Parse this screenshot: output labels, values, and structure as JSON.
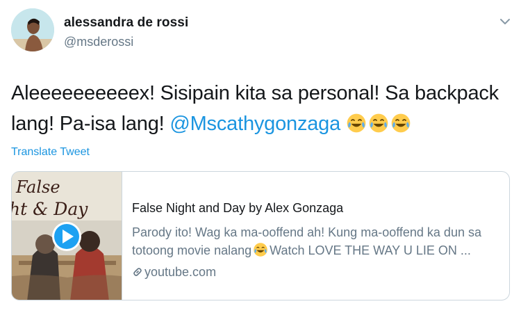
{
  "author": {
    "display_name": "alessandra de rossi",
    "handle": "@msderossi"
  },
  "tweet": {
    "text_main": "Aleeeeeeeeeex! Sisipain kita sa personal! Sa backpack lang! Pa-isa lang!",
    "mention": "@Mscathygonzaga",
    "emoji_name": "face-with-tears-of-joy",
    "emoji_count": 3
  },
  "translate_label": "Translate Tweet",
  "card": {
    "thumbnail_text_line1": "False",
    "thumbnail_text_line2": "ht & Day",
    "title": "False Night and Day by Alex Gonzaga",
    "description_part1": "Parody ito! Wag ka ma-ooffend ah! Kung ma-ooffend ka dun sa totoong movie nalang",
    "description_part2": "Watch LOVE THE WAY U LIE ON ...",
    "domain": "youtube.com",
    "play_icon": "play-icon",
    "link_icon": "link-icon"
  },
  "icons": {
    "caret": "chevron-down-icon"
  },
  "colors": {
    "link_blue": "#1b95e0",
    "secondary_text": "#657786",
    "primary_text": "#14171a",
    "border": "#ccd6dd"
  }
}
